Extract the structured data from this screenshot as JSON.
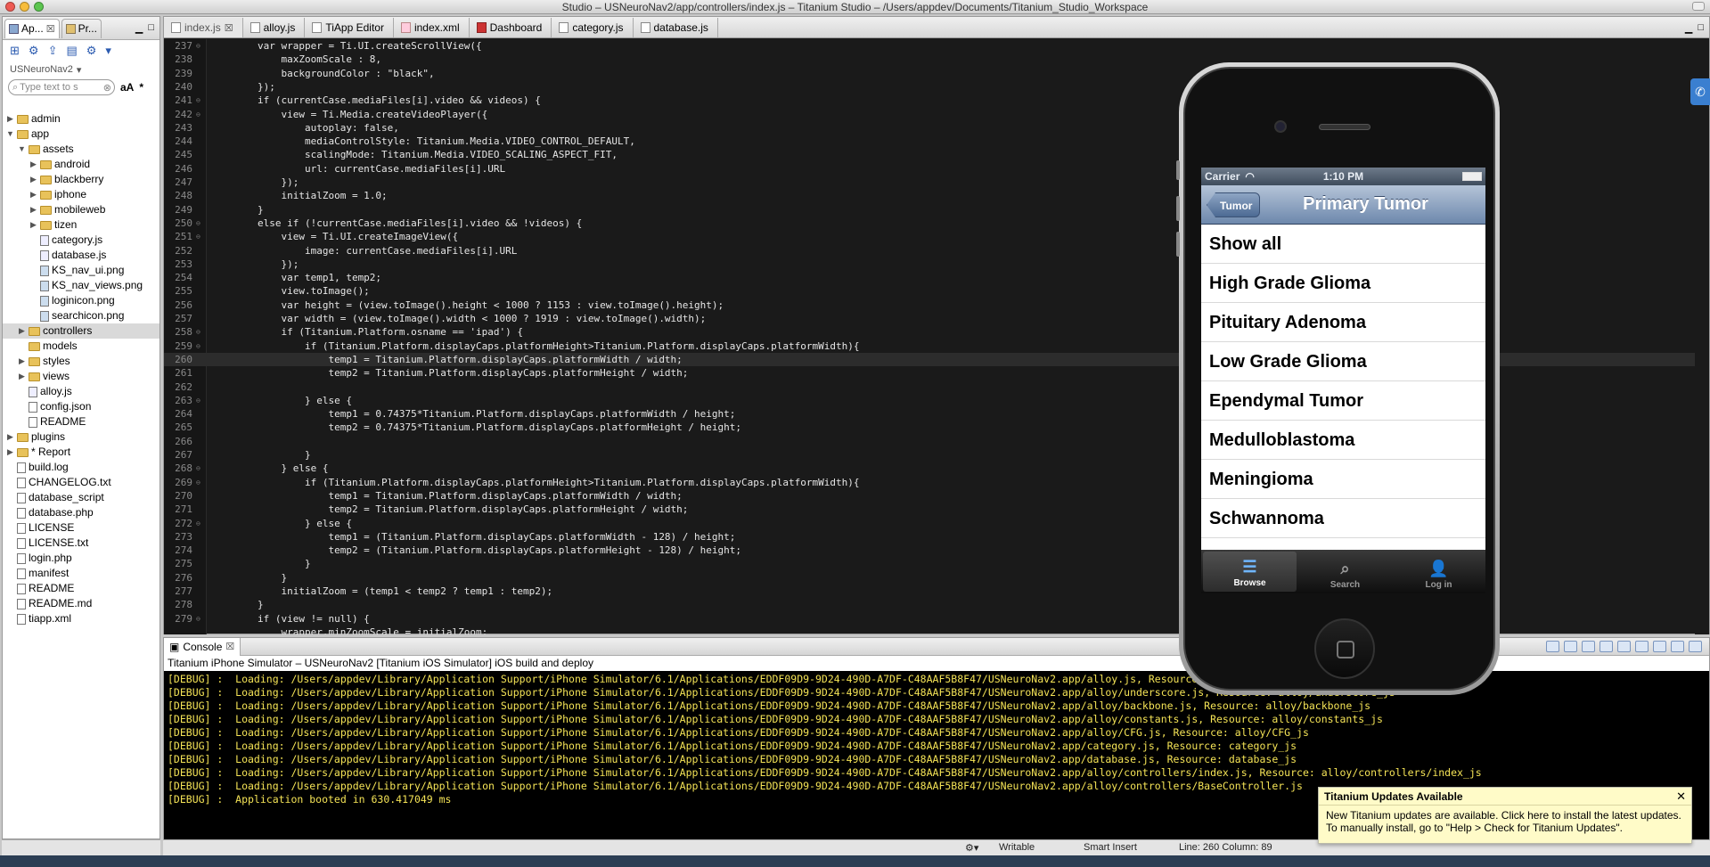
{
  "window": {
    "title": "Studio – USNeuroNav2/app/controllers/index.js – Titanium Studio – /Users/appdev/Documents/Titanium_Studio_Workspace"
  },
  "left_panel": {
    "tabs": [
      {
        "label": "Ap..."
      },
      {
        "label": "Pr..."
      }
    ],
    "project": "USNeuroNav2",
    "filter_placeholder": "Type text to s",
    "filter_case": "aA",
    "filter_regex": "*",
    "tree": [
      {
        "label": "admin",
        "type": "folder",
        "depth": 0,
        "arrow": "▶"
      },
      {
        "label": "app",
        "type": "folder",
        "depth": 0,
        "arrow": "▼"
      },
      {
        "label": "assets",
        "type": "folder",
        "depth": 1,
        "arrow": "▼"
      },
      {
        "label": "android",
        "type": "folder",
        "depth": 2,
        "arrow": "▶"
      },
      {
        "label": "blackberry",
        "type": "folder",
        "depth": 2,
        "arrow": "▶"
      },
      {
        "label": "iphone",
        "type": "folder",
        "depth": 2,
        "arrow": "▶"
      },
      {
        "label": "mobileweb",
        "type": "folder",
        "depth": 2,
        "arrow": "▶"
      },
      {
        "label": "tizen",
        "type": "folder",
        "depth": 2,
        "arrow": "▶"
      },
      {
        "label": "category.js",
        "type": "js",
        "depth": 2,
        "arrow": ""
      },
      {
        "label": "database.js",
        "type": "js",
        "depth": 2,
        "arrow": ""
      },
      {
        "label": "KS_nav_ui.png",
        "type": "img",
        "depth": 2,
        "arrow": ""
      },
      {
        "label": "KS_nav_views.png",
        "type": "img",
        "depth": 2,
        "arrow": ""
      },
      {
        "label": "loginicon.png",
        "type": "img",
        "depth": 2,
        "arrow": ""
      },
      {
        "label": "searchicon.png",
        "type": "img",
        "depth": 2,
        "arrow": ""
      },
      {
        "label": "controllers",
        "type": "folder",
        "depth": 1,
        "arrow": "▶",
        "selected": true
      },
      {
        "label": "models",
        "type": "folder",
        "depth": 1,
        "arrow": ""
      },
      {
        "label": "styles",
        "type": "folder",
        "depth": 1,
        "arrow": "▶"
      },
      {
        "label": "views",
        "type": "folder",
        "depth": 1,
        "arrow": "▶"
      },
      {
        "label": "alloy.js",
        "type": "js",
        "depth": 1,
        "arrow": ""
      },
      {
        "label": "config.json",
        "type": "file",
        "depth": 1,
        "arrow": ""
      },
      {
        "label": "README",
        "type": "file",
        "depth": 1,
        "arrow": ""
      },
      {
        "label": "plugins",
        "type": "folder",
        "depth": 0,
        "arrow": "▶"
      },
      {
        "label": "* Report",
        "type": "folder",
        "depth": 0,
        "arrow": "▶"
      },
      {
        "label": "build.log",
        "type": "file",
        "depth": 0,
        "arrow": ""
      },
      {
        "label": "CHANGELOG.txt",
        "type": "file",
        "depth": 0,
        "arrow": ""
      },
      {
        "label": "database_script",
        "type": "file",
        "depth": 0,
        "arrow": ""
      },
      {
        "label": "database.php",
        "type": "file",
        "depth": 0,
        "arrow": ""
      },
      {
        "label": "LICENSE",
        "type": "file",
        "depth": 0,
        "arrow": ""
      },
      {
        "label": "LICENSE.txt",
        "type": "file",
        "depth": 0,
        "arrow": ""
      },
      {
        "label": "login.php",
        "type": "file",
        "depth": 0,
        "arrow": ""
      },
      {
        "label": "manifest",
        "type": "file",
        "depth": 0,
        "arrow": ""
      },
      {
        "label": "README",
        "type": "file",
        "depth": 0,
        "arrow": ""
      },
      {
        "label": "README.md",
        "type": "file",
        "depth": 0,
        "arrow": ""
      },
      {
        "label": "tiapp.xml",
        "type": "file",
        "depth": 0,
        "arrow": ""
      }
    ]
  },
  "editor": {
    "tabs": [
      {
        "label": "index.js",
        "active": true,
        "icon": "js"
      },
      {
        "label": "alloy.js",
        "active": false,
        "icon": "js"
      },
      {
        "label": "TiApp Editor",
        "active": false,
        "icon": "ti"
      },
      {
        "label": "index.xml",
        "active": false,
        "icon": "xml"
      },
      {
        "label": "Dashboard",
        "active": false,
        "icon": "red"
      },
      {
        "label": "category.js",
        "active": false,
        "icon": "js"
      },
      {
        "label": "database.js",
        "active": false,
        "icon": "js"
      }
    ],
    "current_line": "260",
    "lines": [
      {
        "n": "237",
        "fold": "⊖",
        "code": "        var wrapper = Ti.UI.createScrollView({"
      },
      {
        "n": "238",
        "fold": "",
        "code": "            maxZoomScale : 8,"
      },
      {
        "n": "239",
        "fold": "",
        "code": "            backgroundColor : \"black\","
      },
      {
        "n": "240",
        "fold": "",
        "code": "        });"
      },
      {
        "n": "241",
        "fold": "⊖",
        "code": "        if (currentCase.mediaFiles[i].video && videos) {"
      },
      {
        "n": "242",
        "fold": "⊖",
        "code": "            view = Ti.Media.createVideoPlayer({"
      },
      {
        "n": "243",
        "fold": "",
        "code": "                autoplay: false,"
      },
      {
        "n": "244",
        "fold": "",
        "code": "                mediaControlStyle: Titanium.Media.VIDEO_CONTROL_DEFAULT,"
      },
      {
        "n": "245",
        "fold": "",
        "code": "                scalingMode: Titanium.Media.VIDEO_SCALING_ASPECT_FIT,"
      },
      {
        "n": "246",
        "fold": "",
        "code": "                url: currentCase.mediaFiles[i].URL"
      },
      {
        "n": "247",
        "fold": "",
        "code": "            });"
      },
      {
        "n": "248",
        "fold": "",
        "code": "            initialZoom = 1.0;"
      },
      {
        "n": "249",
        "fold": "",
        "code": "        }"
      },
      {
        "n": "250",
        "fold": "⊖",
        "code": "        else if (!currentCase.mediaFiles[i].video && !videos) {"
      },
      {
        "n": "251",
        "fold": "⊖",
        "code": "            view = Ti.UI.createImageView({"
      },
      {
        "n": "252",
        "fold": "",
        "code": "                image: currentCase.mediaFiles[i].URL"
      },
      {
        "n": "253",
        "fold": "",
        "code": "            });"
      },
      {
        "n": "254",
        "fold": "",
        "code": "            var temp1, temp2;"
      },
      {
        "n": "255",
        "fold": "",
        "code": "            view.toImage();"
      },
      {
        "n": "256",
        "fold": "",
        "code": "            var height = (view.toImage().height < 1000 ? 1153 : view.toImage().height);"
      },
      {
        "n": "257",
        "fold": "",
        "code": "            var width = (view.toImage().width < 1000 ? 1919 : view.toImage().width);"
      },
      {
        "n": "258",
        "fold": "⊖",
        "code": "            if (Titanium.Platform.osname == 'ipad') {"
      },
      {
        "n": "259",
        "fold": "⊖",
        "code": "                if (Titanium.Platform.displayCaps.platformHeight>Titanium.Platform.displayCaps.platformWidth){"
      },
      {
        "n": "260",
        "fold": "",
        "code": "                    temp1 = Titanium.Platform.displayCaps.platformWidth / width;"
      },
      {
        "n": "261",
        "fold": "",
        "code": "                    temp2 = Titanium.Platform.displayCaps.platformHeight / width;"
      },
      {
        "n": "262",
        "fold": "",
        "code": ""
      },
      {
        "n": "263",
        "fold": "⊖",
        "code": "                } else {"
      },
      {
        "n": "264",
        "fold": "",
        "code": "                    temp1 = 0.74375*Titanium.Platform.displayCaps.platformWidth / height;"
      },
      {
        "n": "265",
        "fold": "",
        "code": "                    temp2 = 0.74375*Titanium.Platform.displayCaps.platformHeight / height;"
      },
      {
        "n": "266",
        "fold": "",
        "code": ""
      },
      {
        "n": "267",
        "fold": "",
        "code": "                }"
      },
      {
        "n": "268",
        "fold": "⊖",
        "code": "            } else {"
      },
      {
        "n": "269",
        "fold": "⊖",
        "code": "                if (Titanium.Platform.displayCaps.platformHeight>Titanium.Platform.displayCaps.platformWidth){"
      },
      {
        "n": "270",
        "fold": "",
        "code": "                    temp1 = Titanium.Platform.displayCaps.platformWidth / width;"
      },
      {
        "n": "271",
        "fold": "",
        "code": "                    temp2 = Titanium.Platform.displayCaps.platformHeight / width;"
      },
      {
        "n": "272",
        "fold": "⊖",
        "code": "                } else {"
      },
      {
        "n": "273",
        "fold": "",
        "code": "                    temp1 = (Titanium.Platform.displayCaps.platformWidth - 128) / height;"
      },
      {
        "n": "274",
        "fold": "",
        "code": "                    temp2 = (Titanium.Platform.displayCaps.platformHeight - 128) / height;"
      },
      {
        "n": "275",
        "fold": "",
        "code": "                }"
      },
      {
        "n": "276",
        "fold": "",
        "code": "            }"
      },
      {
        "n": "277",
        "fold": "",
        "code": "            initialZoom = (temp1 < temp2 ? temp1 : temp2);"
      },
      {
        "n": "278",
        "fold": "",
        "code": "        }"
      },
      {
        "n": "279",
        "fold": "⊖",
        "code": "        if (view != null) {"
      },
      {
        "n": "",
        "fold": "",
        "code": "            wrapper.minZoomScale = initialZoom;"
      }
    ]
  },
  "simulator": {
    "carrier": "Carrier",
    "time": "1:10 PM",
    "back_label": "Tumor",
    "nav_title": "Primary Tumor",
    "rows": [
      "Show all",
      "High Grade Glioma",
      "Pituitary Adenoma",
      "Low Grade Glioma",
      "Ependymal Tumor",
      "Medulloblastoma",
      "Meningioma",
      "Schwannoma"
    ],
    "tabbar": [
      {
        "label": "Browse",
        "icon": "list-icon",
        "active": true
      },
      {
        "label": "Search",
        "icon": "magnifier-icon",
        "active": false
      },
      {
        "label": "Log in",
        "icon": "person-icon",
        "active": false
      }
    ]
  },
  "console": {
    "tab_label": "Console",
    "description": "Titanium iPhone Simulator – USNeuroNav2 [Titanium iOS Simulator] iOS build and deploy",
    "lines": [
      "[DEBUG] :  Loading: /Users/appdev/Library/Application Support/iPhone Simulator/6.1/Applications/EDDF09D9-9D24-490D-A7DF-C48AAF5B8F47/USNeuroNav2.app/alloy.js, Resource: alloy_js",
      "[DEBUG] :  Loading: /Users/appdev/Library/Application Support/iPhone Simulator/6.1/Applications/EDDF09D9-9D24-490D-A7DF-C48AAF5B8F47/USNeuroNav2.app/alloy/underscore.js, Resource: alloy/underscore_js",
      "[DEBUG] :  Loading: /Users/appdev/Library/Application Support/iPhone Simulator/6.1/Applications/EDDF09D9-9D24-490D-A7DF-C48AAF5B8F47/USNeuroNav2.app/alloy/backbone.js, Resource: alloy/backbone_js",
      "[DEBUG] :  Loading: /Users/appdev/Library/Application Support/iPhone Simulator/6.1/Applications/EDDF09D9-9D24-490D-A7DF-C48AAF5B8F47/USNeuroNav2.app/alloy/constants.js, Resource: alloy/constants_js",
      "[DEBUG] :  Loading: /Users/appdev/Library/Application Support/iPhone Simulator/6.1/Applications/EDDF09D9-9D24-490D-A7DF-C48AAF5B8F47/USNeuroNav2.app/alloy/CFG.js, Resource: alloy/CFG_js",
      "[DEBUG] :  Loading: /Users/appdev/Library/Application Support/iPhone Simulator/6.1/Applications/EDDF09D9-9D24-490D-A7DF-C48AAF5B8F47/USNeuroNav2.app/category.js, Resource: category_js",
      "[DEBUG] :  Loading: /Users/appdev/Library/Application Support/iPhone Simulator/6.1/Applications/EDDF09D9-9D24-490D-A7DF-C48AAF5B8F47/USNeuroNav2.app/database.js, Resource: database_js",
      "[DEBUG] :  Loading: /Users/appdev/Library/Application Support/iPhone Simulator/6.1/Applications/EDDF09D9-9D24-490D-A7DF-C48AAF5B8F47/USNeuroNav2.app/alloy/controllers/index.js, Resource: alloy/controllers/index_js",
      "[DEBUG] :  Loading: /Users/appdev/Library/Application Support/iPhone Simulator/6.1/Applications/EDDF09D9-9D24-490D-A7DF-C48AAF5B8F47/USNeuroNav2.app/alloy/controllers/BaseController.js",
      "[DEBUG] :  Application booted in 630.417049 ms"
    ]
  },
  "statusbar": {
    "writable": "Writable",
    "insert_mode": "Smart Insert",
    "position": "Line: 260 Column: 89"
  },
  "notification": {
    "title": "Titanium Updates Available",
    "line1": "New Titanium updates are available. Click here to install the latest updates.",
    "line2": "To manually install, go to \"Help > Check for Titanium Updates\"."
  },
  "colors": {
    "editor_bg": "#1a1a1a",
    "console_text": "#f4e356",
    "nav_blue": "#6d88ac"
  }
}
